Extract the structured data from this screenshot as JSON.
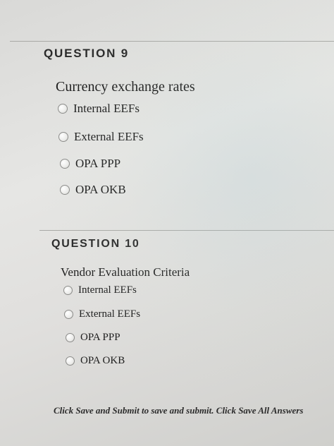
{
  "questions": [
    {
      "header": "QUESTION 9",
      "text": "Currency exchange rates",
      "options": [
        "Internal EEFs",
        "External EEFs",
        "OPA PPP",
        "OPA OKB"
      ]
    },
    {
      "header": "QUESTION 10",
      "text": "Vendor Evaluation Criteria",
      "options": [
        "Internal EEFs",
        "External EEFs",
        "OPA PPP",
        "OPA OKB"
      ]
    }
  ],
  "footer": {
    "instructions": "Click Save and Submit to save and submit. Click Save All Answers"
  },
  "colors": {
    "background": "#e0dfdd",
    "divider": "#a9a9a6",
    "text": "#1e1e1e"
  }
}
